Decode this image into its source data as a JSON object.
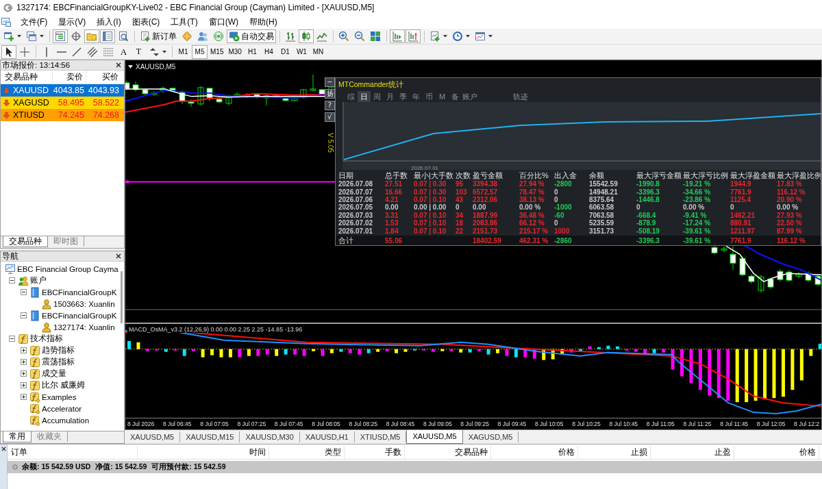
{
  "window": {
    "title": "1327174: EBCFinancialGroupKY-Live02 - EBC Financial Group (Cayman) Limited - [XAUUSD,M5]"
  },
  "menu": [
    "文件(F)",
    "显示(V)",
    "插入(I)",
    "图表(C)",
    "工具(T)",
    "窗口(W)",
    "帮助(H)"
  ],
  "toolbar_main": [
    [
      {
        "kind": "new-chart",
        "pressed": false,
        "dropdown": true
      },
      {
        "kind": "profiles",
        "pressed": false,
        "dropdown": true
      }
    ],
    [
      {
        "kind": "market-watch",
        "pressed": true,
        "dropdown": false
      },
      {
        "kind": "data-window",
        "pressed": false,
        "dropdown": false
      },
      {
        "kind": "navigator",
        "pressed": true,
        "dropdown": false
      },
      {
        "kind": "terminal",
        "pressed": true,
        "dropdown": false
      },
      {
        "kind": "tester",
        "pressed": false,
        "dropdown": false
      }
    ],
    [
      {
        "kind": "new-order",
        "label": "新订单",
        "pressed": false,
        "dropdown": false
      },
      {
        "kind": "editor",
        "pressed": false,
        "dropdown": false
      },
      {
        "kind": "community",
        "pressed": false,
        "dropdown": false
      },
      {
        "kind": "signals",
        "pressed": false,
        "dropdown": false
      },
      {
        "kind": "auto-trading",
        "label": "自动交易",
        "pressed": true,
        "dropdown": false
      }
    ],
    [
      {
        "kind": "bar-chart",
        "pressed": false,
        "dropdown": false
      },
      {
        "kind": "candle-chart",
        "pressed": true,
        "dropdown": false
      },
      {
        "kind": "line-chart",
        "pressed": false,
        "dropdown": false
      }
    ],
    [
      {
        "kind": "zoom-in",
        "pressed": false,
        "dropdown": false
      },
      {
        "kind": "zoom-out",
        "pressed": false,
        "dropdown": false
      },
      {
        "kind": "tile",
        "pressed": false,
        "dropdown": false
      }
    ],
    [
      {
        "kind": "auto-scroll",
        "pressed": true,
        "dropdown": false
      },
      {
        "kind": "chart-shift",
        "pressed": true,
        "dropdown": false
      }
    ],
    [
      {
        "kind": "indicators",
        "pressed": false,
        "dropdown": true
      },
      {
        "kind": "periods",
        "pressed": false,
        "dropdown": true
      },
      {
        "kind": "templates",
        "pressed": false,
        "dropdown": true
      }
    ]
  ],
  "toolbar_drawing": [
    [
      {
        "kind": "cursor",
        "pressed": true,
        "dropdown": false
      },
      {
        "kind": "crosshair",
        "pressed": false,
        "dropdown": false
      }
    ],
    [
      {
        "kind": "vertical-line",
        "pressed": false,
        "dropdown": false
      },
      {
        "kind": "horizontal-line",
        "pressed": false,
        "dropdown": false
      },
      {
        "kind": "trendline",
        "pressed": false,
        "dropdown": false
      },
      {
        "kind": "channel",
        "pressed": false,
        "dropdown": false
      },
      {
        "kind": "fibonacci",
        "pressed": false,
        "dropdown": false
      },
      {
        "kind": "text",
        "label": "A",
        "pressed": false,
        "dropdown": false
      },
      {
        "kind": "label",
        "label": "T",
        "pressed": false,
        "dropdown": false
      },
      {
        "kind": "arrows",
        "pressed": false,
        "dropdown": true
      }
    ],
    [
      {
        "kind": "period",
        "label": "M1",
        "pressed": false,
        "dropdown": false
      },
      {
        "kind": "period",
        "label": "M5",
        "pressed": true,
        "dropdown": false
      },
      {
        "kind": "period",
        "label": "M15",
        "pressed": false,
        "dropdown": false
      },
      {
        "kind": "period",
        "label": "M30",
        "pressed": false,
        "dropdown": false
      },
      {
        "kind": "period",
        "label": "H1",
        "pressed": false,
        "dropdown": false
      },
      {
        "kind": "period",
        "label": "H4",
        "pressed": false,
        "dropdown": false
      },
      {
        "kind": "period",
        "label": "D1",
        "pressed": false,
        "dropdown": false
      },
      {
        "kind": "period",
        "label": "W1",
        "pressed": false,
        "dropdown": false
      },
      {
        "kind": "period",
        "label": "MN",
        "pressed": false,
        "dropdown": false
      }
    ]
  ],
  "market_watch": {
    "title": "市场报价: 13:14:56",
    "columns": [
      "交易品种",
      "卖价",
      "买价"
    ],
    "rows": [
      {
        "symbol": "XAUUSD",
        "bid": "4043.85",
        "ask": "4043.93",
        "kind": "down",
        "selected": true
      },
      {
        "symbol": "XAGUSD",
        "bid": "58.495",
        "ask": "58.522",
        "kind": "down",
        "selected": false,
        "color": "#ffd800"
      },
      {
        "symbol": "XTIUSD",
        "bid": "74.245",
        "ask": "74.268",
        "kind": "down",
        "selected": false,
        "color": "#ffa000"
      }
    ],
    "tabs": [
      {
        "label": "交易品种",
        "selected": true
      },
      {
        "label": "即时图",
        "selected": false
      }
    ]
  },
  "navigator": {
    "title": "导航",
    "tree": [
      {
        "label": "EBC Financial Group Cayma",
        "kind": "broker",
        "children": [
          {
            "label": "账户",
            "kind": "accounts",
            "expanded": true,
            "children": [
              {
                "label": "EBCFinancialGroupK",
                "kind": "server",
                "expanded": true,
                "children": [
                  {
                    "label": "1503663: Xuanlin",
                    "kind": "account"
                  }
                ]
              },
              {
                "label": "EBCFinancialGroupK",
                "kind": "server",
                "expanded": true,
                "children": [
                  {
                    "label": "1327174: Xuanlin",
                    "kind": "account"
                  }
                ]
              }
            ]
          },
          {
            "label": "技术指标",
            "kind": "group",
            "expanded": true,
            "children": [
              {
                "label": "趋势指标",
                "kind": "group",
                "expanded": false
              },
              {
                "label": "震荡指标",
                "kind": "group",
                "expanded": false
              },
              {
                "label": "成交量",
                "kind": "group",
                "expanded": false
              },
              {
                "label": "比尔 威廉姆",
                "kind": "group",
                "expanded": false
              },
              {
                "label": "Examples",
                "kind": "custom-group",
                "expanded": false
              },
              {
                "label": "Accelerator",
                "kind": "indicator"
              },
              {
                "label": "Accumulation",
                "kind": "indicator"
              }
            ]
          }
        ]
      }
    ],
    "tabs": [
      {
        "label": "常用",
        "selected": true
      },
      {
        "label": "收藏夹",
        "selected": false
      }
    ]
  },
  "chart": {
    "title": "XAUUSD,M5",
    "side_buttons": [
      "−",
      "扬",
      "?",
      "√"
    ],
    "version": "V 5.05",
    "commander": {
      "title": "MTCommander统计",
      "tabs": [
        {
          "label": "综",
          "selected": false
        },
        {
          "label": "日",
          "selected": true
        },
        {
          "label": "周",
          "selected": false
        },
        {
          "label": "月",
          "selected": false
        },
        {
          "label": "季",
          "selected": false
        },
        {
          "label": "年",
          "selected": false
        },
        {
          "label": "币",
          "selected": false
        },
        {
          "label": "M",
          "selected": false
        },
        {
          "label": "备",
          "selected": false
        },
        {
          "label": "账户",
          "selected": false
        }
      ],
      "track_tab": {
        "label": "轨迹",
        "selected": false
      },
      "curve_label": "2026.07.01",
      "columns": [
        "日期",
        "总手数",
        "最小|大手数",
        "次数",
        "盈亏金额",
        "百分比%",
        "出入金",
        "余额",
        "最大浮亏金额",
        "最大浮亏比例",
        "最大浮盈金额",
        "最大浮盈比例"
      ],
      "rows": [
        {
          "cells": [
            {
              "text": "2026.07.08",
              "color": "#c8c8c8"
            },
            {
              "text": "27.51",
              "color": "#e8262b"
            },
            {
              "text": "0.07 | 0.30",
              "color": "#e8262b"
            },
            {
              "text": "95",
              "color": "#e8262b"
            },
            {
              "text": "3394.38",
              "color": "#e8262b"
            },
            {
              "text": "27.94 %",
              "color": "#e8262b"
            },
            {
              "text": "-2800",
              "color": "#22cc55"
            },
            {
              "text": "15542.59",
              "color": "#c8c8c8"
            },
            {
              "text": "-1990.8",
              "color": "#22cc55"
            },
            {
              "text": "-19.21 %",
              "color": "#22cc55"
            },
            {
              "text": "1944.9",
              "color": "#e8262b"
            },
            {
              "text": "17.83 %",
              "color": "#e8262b"
            }
          ]
        },
        {
          "cells": [
            {
              "text": "2026.07.07",
              "color": "#c8c8c8"
            },
            {
              "text": "16.66",
              "color": "#e8262b"
            },
            {
              "text": "0.07 | 0.30",
              "color": "#e8262b"
            },
            {
              "text": "103",
              "color": "#e8262b"
            },
            {
              "text": "6572.57",
              "color": "#e8262b"
            },
            {
              "text": "78.47 %",
              "color": "#e8262b"
            },
            {
              "text": "0",
              "color": "#c8c8c8"
            },
            {
              "text": "14948.21",
              "color": "#c8c8c8"
            },
            {
              "text": "-3396.3",
              "color": "#22cc55"
            },
            {
              "text": "-34.66 %",
              "color": "#22cc55"
            },
            {
              "text": "7761.9",
              "color": "#e8262b"
            },
            {
              "text": "116.12 %",
              "color": "#e8262b"
            }
          ]
        },
        {
          "cells": [
            {
              "text": "2026.07.06",
              "color": "#c8c8c8"
            },
            {
              "text": "4.21",
              "color": "#e8262b"
            },
            {
              "text": "0.07 | 0.10",
              "color": "#e8262b"
            },
            {
              "text": "43",
              "color": "#e8262b"
            },
            {
              "text": "2312.06",
              "color": "#e8262b"
            },
            {
              "text": "38.13 %",
              "color": "#e8262b"
            },
            {
              "text": "0",
              "color": "#c8c8c8"
            },
            {
              "text": "8375.64",
              "color": "#c8c8c8"
            },
            {
              "text": "-1446.8",
              "color": "#22cc55"
            },
            {
              "text": "-23.86 %",
              "color": "#22cc55"
            },
            {
              "text": "1125.4",
              "color": "#e8262b"
            },
            {
              "text": "20.90 %",
              "color": "#e8262b"
            }
          ]
        },
        {
          "cells": [
            {
              "text": "2026.07.05",
              "color": "#c8c8c8"
            },
            {
              "text": "0.00",
              "color": "#c8c8c8"
            },
            {
              "text": "0.00 | 0.00",
              "color": "#c8c8c8"
            },
            {
              "text": "0",
              "color": "#c8c8c8"
            },
            {
              "text": "0.00",
              "color": "#c8c8c8"
            },
            {
              "text": "0.00 %",
              "color": "#c8c8c8"
            },
            {
              "text": "-1000",
              "color": "#22cc55"
            },
            {
              "text": "6063.58",
              "color": "#c8c8c8"
            },
            {
              "text": "0",
              "color": "#c8c8c8"
            },
            {
              "text": "0.00 %",
              "color": "#c8c8c8"
            },
            {
              "text": "0",
              "color": "#c8c8c8"
            },
            {
              "text": "0.00 %",
              "color": "#c8c8c8"
            }
          ]
        },
        {
          "cells": [
            {
              "text": "2026.07.03",
              "color": "#c8c8c8"
            },
            {
              "text": "3.31",
              "color": "#e8262b"
            },
            {
              "text": "0.07 | 0.10",
              "color": "#e8262b"
            },
            {
              "text": "34",
              "color": "#e8262b"
            },
            {
              "text": "1887.99",
              "color": "#e8262b"
            },
            {
              "text": "36.48 %",
              "color": "#e8262b"
            },
            {
              "text": "-60",
              "color": "#22cc55"
            },
            {
              "text": "7063.58",
              "color": "#c8c8c8"
            },
            {
              "text": "-668.4",
              "color": "#22cc55"
            },
            {
              "text": "-9.41 %",
              "color": "#22cc55"
            },
            {
              "text": "1462.21",
              "color": "#e8262b"
            },
            {
              "text": "27.93 %",
              "color": "#e8262b"
            }
          ]
        },
        {
          "cells": [
            {
              "text": "2026.07.02",
              "color": "#c8c8c8"
            },
            {
              "text": "1.53",
              "color": "#e8262b"
            },
            {
              "text": "0.07 | 0.10",
              "color": "#e8262b"
            },
            {
              "text": "18",
              "color": "#e8262b"
            },
            {
              "text": "2083.86",
              "color": "#e8262b"
            },
            {
              "text": "66.12 %",
              "color": "#e8262b"
            },
            {
              "text": "0",
              "color": "#c8c8c8"
            },
            {
              "text": "5235.59",
              "color": "#c8c8c8"
            },
            {
              "text": "-878.9",
              "color": "#22cc55"
            },
            {
              "text": "-17.24 %",
              "color": "#22cc55"
            },
            {
              "text": "880.91",
              "color": "#e8262b"
            },
            {
              "text": "22.50 %",
              "color": "#e8262b"
            }
          ]
        },
        {
          "cells": [
            {
              "text": "2026.07.01",
              "color": "#c8c8c8"
            },
            {
              "text": "1.84",
              "color": "#e8262b"
            },
            {
              "text": "0.07 | 0.10",
              "color": "#e8262b"
            },
            {
              "text": "22",
              "color": "#e8262b"
            },
            {
              "text": "2151.73",
              "color": "#e8262b"
            },
            {
              "text": "215.17 %",
              "color": "#e8262b"
            },
            {
              "text": "1000",
              "color": "#e8262b"
            },
            {
              "text": "3151.73",
              "color": "#c8c8c8"
            },
            {
              "text": "-508.19",
              "color": "#22cc55"
            },
            {
              "text": "-39.61 %",
              "color": "#22cc55"
            },
            {
              "text": "1211.97",
              "color": "#e8262b"
            },
            {
              "text": "87.99 %",
              "color": "#e8262b"
            }
          ]
        }
      ],
      "total": {
        "label": "合计",
        "total_lots": {
          "text": "55.06",
          "color": "#e8262b"
        },
        "profit": {
          "text": "18402.59",
          "color": "#e8262b"
        },
        "percent": {
          "text": "462.31 %",
          "color": "#e8262b"
        },
        "deposits": {
          "text": "-2860",
          "color": "#22cc55"
        },
        "max_float_loss": {
          "text": "-3396.3",
          "color": "#22cc55"
        },
        "max_float_loss_pct": {
          "text": "-39.61 %",
          "color": "#22cc55"
        },
        "max_float_profit": {
          "text": "7761.9",
          "color": "#e8262b"
        },
        "max_float_profit_pct": {
          "text": "116.12 %",
          "color": "#e8262b"
        }
      }
    },
    "indicator_label": "MACD_OsMA_v3.2 (12,26,9) 0.00 0.00 2.25 2.25 -14.85 -13.96",
    "time_axis": [
      "8 Jul 2026",
      "8 Jul 06:45",
      "8 Jul 07:05",
      "8 Jul 07:25",
      "8 Jul 07:45",
      "8 Jul 08:05",
      "8 Jul 08:25",
      "8 Jul 08:45",
      "8 Jul 09:05",
      "8 Jul 09:25",
      "8 Jul 09:45",
      "8 Jul 10:05",
      "8 Jul 10:25",
      "8 Jul 10:45",
      "8 Jul 11:05",
      "8 Jul 11:25",
      "8 Jul 11:45",
      "8 Jul 12:05",
      "8 Jul 12:2"
    ]
  },
  "chart_tabs": [
    {
      "label": "XAUUSD,M5",
      "selected": false
    },
    {
      "label": "XAUUSD,M15",
      "selected": false
    },
    {
      "label": "XAUUSD,M30",
      "selected": false
    },
    {
      "label": "XAUUSD,H1",
      "selected": false
    },
    {
      "label": "XTIUSD,M5",
      "selected": false
    },
    {
      "label": "XAUUSD,M5",
      "selected": true
    },
    {
      "label": "XAGUSD,M5",
      "selected": false
    }
  ],
  "terminal": {
    "columns": [
      "订单",
      "时间",
      "类型",
      "手数",
      "交易品种",
      "价格",
      "止损",
      "止盈",
      "价格"
    ],
    "balance": [
      "余额: 15 542.59 USD",
      "净值: 15 542.59",
      "可用预付款: 15 542.59"
    ]
  }
}
